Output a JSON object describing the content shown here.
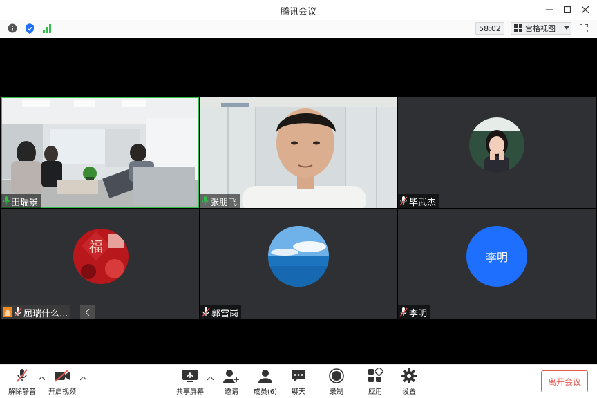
{
  "window": {
    "title": "腾讯会议"
  },
  "toolbar": {
    "timer": "58:02",
    "view_label": "宫格视图"
  },
  "participants": [
    {
      "name": "田瑞景",
      "mic": "on"
    },
    {
      "name": "张朋飞",
      "mic": "on"
    },
    {
      "name": "毕武杰",
      "mic": "muted"
    },
    {
      "name": "屈瑞什么...",
      "mic": "muted"
    },
    {
      "name": "郭雷岗",
      "mic": "muted"
    },
    {
      "name": "李明",
      "mic": "muted",
      "avatar_text": "李明"
    }
  ],
  "controls": {
    "unmute": "解除静音",
    "start_video": "开启视频",
    "share_screen": "共享屏幕",
    "invite": "邀请",
    "members": "成员(6)",
    "chat": "聊天",
    "record": "录制",
    "apps": "应用",
    "settings": "设置",
    "leave": "离开会议"
  },
  "colors": {
    "accent": "#1f6fff",
    "active_border": "#2fbf4a",
    "leave": "#e5584f",
    "tile_bg": "#2e3033"
  }
}
